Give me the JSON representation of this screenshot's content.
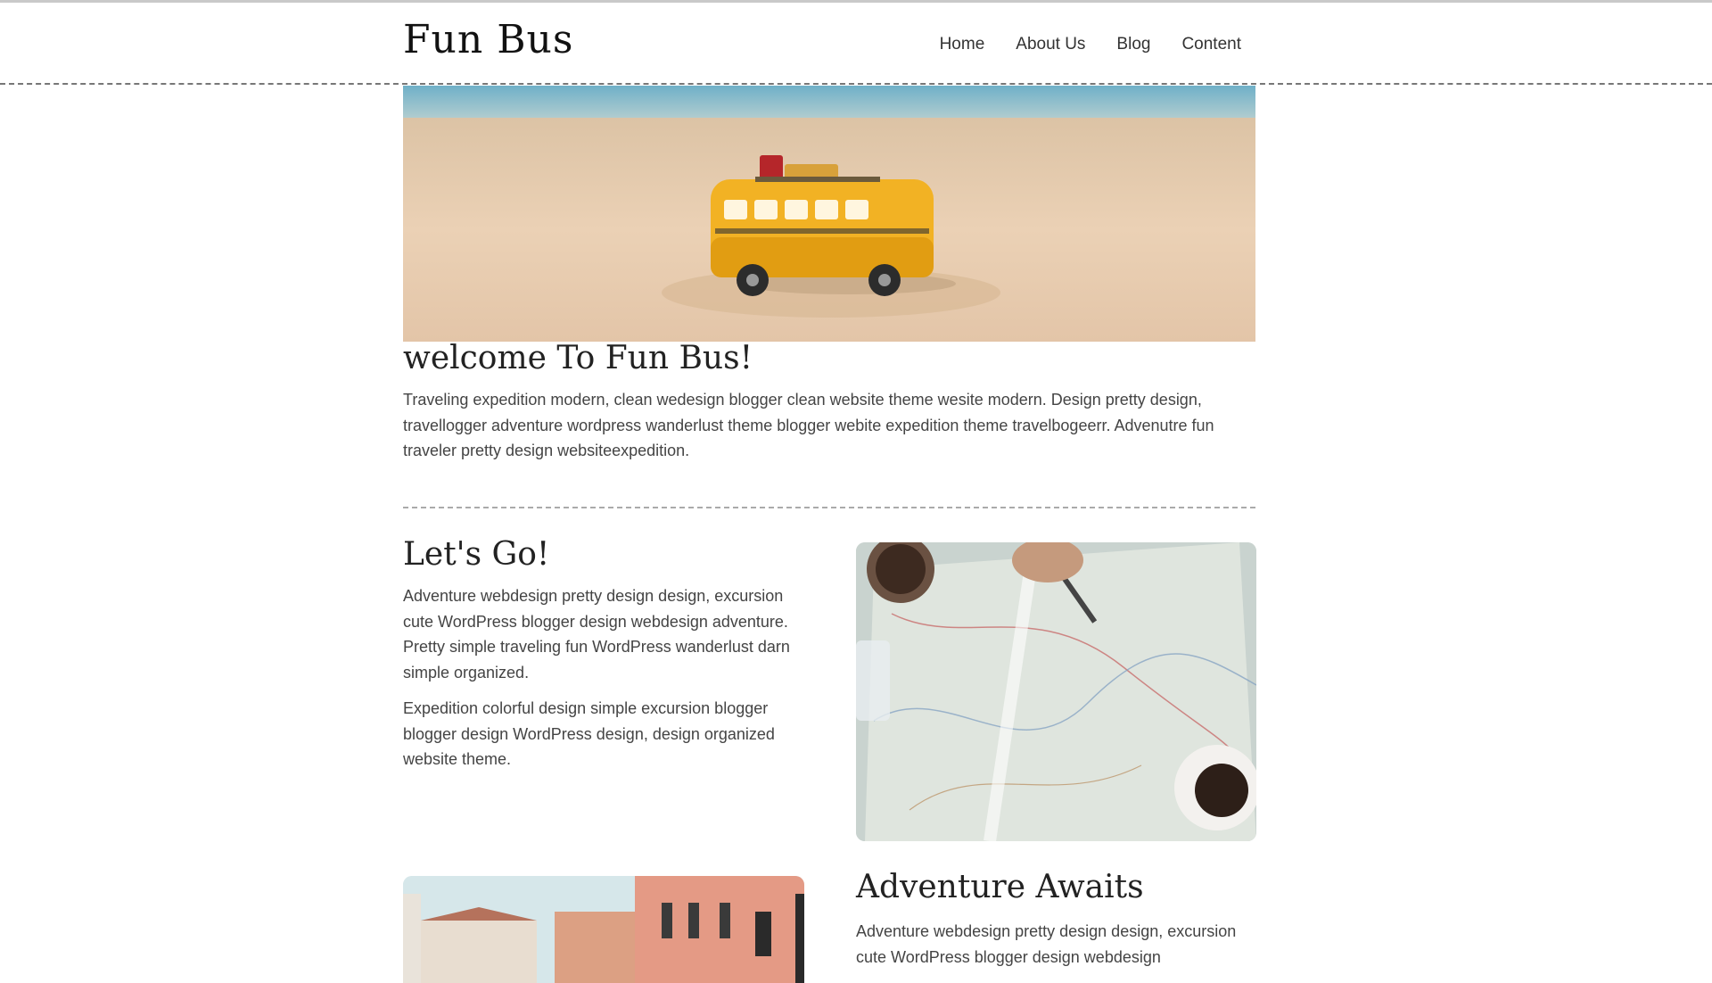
{
  "header": {
    "logo": "Fun Bus",
    "nav": [
      "Home",
      "About Us",
      "Blog",
      "Content"
    ]
  },
  "welcome": {
    "title": "welcome To Fun Bus!",
    "text": "Traveling expedition modern, clean wedesign blogger clean website theme wesite modern. Design pretty design, travellogger adventure wordpress wanderlust theme blogger webite expedition theme travelbogeerr. Advenutre fun traveler pretty design websiteexpedition."
  },
  "lets_go": {
    "title": "Let's Go!",
    "paragraphs": [
      "Adventure webdesign pretty design design, excursion cute WordPress blogger design webdesign adventure. Pretty simple traveling fun WordPress wanderlust darn simple organized.",
      "Expedition colorful design simple excursion blogger blogger design WordPress design, design organized website theme."
    ]
  },
  "adventure": {
    "title": "Adventure Awaits",
    "text": "Adventure webdesign pretty design design, excursion cute WordPress blogger design webdesign"
  },
  "images": {
    "hero": "toy-bus-on-beach",
    "map": "map-with-coffee",
    "venice": "venice-buildings"
  }
}
